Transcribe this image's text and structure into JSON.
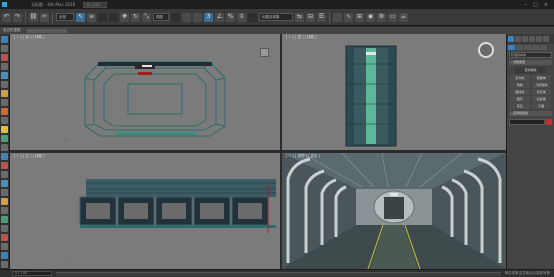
{
  "titlebar": {
    "title": "无标题 - 3ds Max 2016",
    "search_placeholder": "键入关键字",
    "minimize": "–",
    "maximize": "□",
    "close": "×"
  },
  "toolbar": {
    "undo": "↶",
    "redo": "↷",
    "link": "⛓",
    "unlink": "✂",
    "select_filter": "全部",
    "select": "↖",
    "select_by_name": "≡",
    "move": "✥",
    "rotate": "↻",
    "scale": "⤡",
    "reference": "视图",
    "snap": "3",
    "angle_snap": "∠",
    "percent_snap": "%",
    "spinner_snap": "⇕",
    "named_selection": "创建选择集",
    "mirror": "⇆",
    "align": "⊟",
    "layers": "☰",
    "curve": "∿",
    "schematic": "⊞",
    "material": "◉",
    "render_setup": "⚙",
    "render_frame": "▭",
    "render": "☕"
  },
  "subbar": {
    "label": "多边形建模"
  },
  "viewports": {
    "top_left_label": "[ + ] [ 前 ] [ 线框 ]",
    "top_right_label": "[ + ] [ 顶 ] [ 线框 ]",
    "bottom_left_label": "[ + ] [ 左 ] [ 线框 ]",
    "bottom_right_label": "[ + ] [ 透视 ] [ 真实 ]"
  },
  "command_panel": {
    "object_type_dropdown": "标准基本体",
    "rollout_object_type": "- 对象类型",
    "autogrid": "自动栅格",
    "buttons": [
      "长方体",
      "圆锥体",
      "球体",
      "几何球体",
      "圆柱体",
      "管状体",
      "圆环",
      "四棱锥",
      "茶壶",
      "平面"
    ],
    "rollout_name_color": "- 名称和颜色"
  },
  "statusbar": {
    "frame_text": "0 / 100",
    "hint": "单击或单击并拖动以选择对象"
  },
  "colors": {
    "accent": "#3b83b8",
    "active_viewport_border": "#e0c040",
    "viewport_bg": "#7b7b7b",
    "wire_teal": "#2f6f6a",
    "object_color": "#c83232"
  }
}
